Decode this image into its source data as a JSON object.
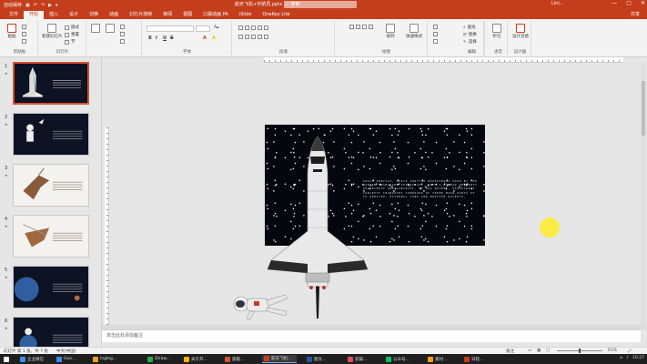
{
  "titlebar": {
    "qa_icons": [
      "autosave-icon",
      "save-icon",
      "undo-icon",
      "redo-icon",
      "present-icon",
      "more-icon"
    ],
    "autosave_label": "自动保存",
    "doc_title": "航天飞机+宇航员.pptx",
    "search_placeholder": "搜索",
    "user": "Lini...",
    "controls": [
      "—",
      "▢",
      "✕"
    ]
  },
  "tabs": [
    "文件",
    "开始",
    "插入",
    "设计",
    "切换",
    "动画",
    "幻灯片放映",
    "审阅",
    "视图",
    "口袋动画 PA",
    "iSlide",
    "OneKey Lite"
  ],
  "active_tab": "开始",
  "share_label": "共享",
  "ribbon": {
    "groups": [
      {
        "name": "剪贴板",
        "buttons": [
          "粘贴"
        ]
      },
      {
        "name": "幻灯片",
        "buttons": [
          "新建幻灯片",
          "版式",
          "重置",
          "节"
        ]
      },
      {
        "name": "字体",
        "buttons": [
          "B",
          "I",
          "U",
          "S"
        ]
      },
      {
        "name": "段落",
        "buttons": []
      },
      {
        "name": "绘图",
        "buttons": [
          "形状",
          "排列",
          "快速样式"
        ]
      },
      {
        "name": "编辑",
        "buttons": [
          "查找",
          "替换",
          "选择"
        ]
      },
      {
        "name": "语音",
        "buttons": [
          "听写"
        ]
      },
      {
        "name": "设计器",
        "buttons": [
          "设计灵感"
        ]
      }
    ]
  },
  "slides": [
    {
      "num": "1",
      "theme": "dark",
      "active": true
    },
    {
      "num": "2",
      "theme": "dark",
      "active": false
    },
    {
      "num": "3",
      "theme": "light",
      "active": false
    },
    {
      "num": "4",
      "theme": "light",
      "active": false
    },
    {
      "num": "5",
      "theme": "dark",
      "active": false
    },
    {
      "num": "6",
      "theme": "dark",
      "active": false
    }
  ],
  "slide_body": "SPACE SHUTTLE, SPACE SHUTTLE REPEATEDLY USED BY THE MANNED TRANSPORT SPACECRAFT, WITH A HYBRID PROPERTY SPACECRAFT AND AIRCRAFT, IT HAS ROCKET, SPACECRAFT CONCEPTS TRANSPORT COMPOSED OF THREE MAIN PARTS OF TH ORBITER, EXTERNAL TANK AND BOOSTER ROCKETS,",
  "notes_placeholder": "单击此处添加备注",
  "status": {
    "slide_info": "幻灯片 第 1 张，共 7 张",
    "lang": "中文(中国)",
    "notes_label": "备注",
    "zoom": "61%"
  },
  "taskbar": {
    "items": [
      {
        "label": "",
        "color": "#ffffff",
        "active": false
      },
      {
        "label": "企业微信",
        "color": "#3a8ee6",
        "active": false
      },
      {
        "label": "Goo...",
        "color": "#4285f4",
        "active": false
      },
      {
        "label": "Ingleg...",
        "color": "#e8a32a",
        "active": false
      },
      {
        "label": "iDraw...",
        "color": "#34a853",
        "active": false
      },
      {
        "label": "关于开...",
        "color": "#f4b400",
        "active": false
      },
      {
        "label": "旗舰...",
        "color": "#d35230",
        "active": false
      },
      {
        "label": "航天飞机...",
        "color": "#c43e1c",
        "active": true
      },
      {
        "label": "图文...",
        "color": "#2b579a",
        "active": false
      },
      {
        "label": "剪辑...",
        "color": "#e04f5f",
        "active": false
      },
      {
        "label": "公众号...",
        "color": "#07c160",
        "active": false
      },
      {
        "label": "素材...",
        "color": "#f4a024",
        "active": false
      },
      {
        "label": "日程...",
        "color": "#c43e1c",
        "active": false
      }
    ],
    "time": "10:27"
  }
}
